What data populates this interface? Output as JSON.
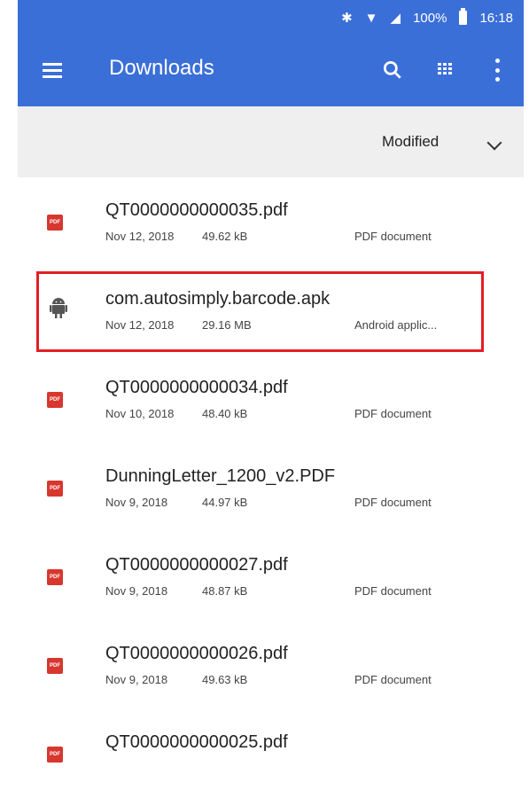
{
  "status": {
    "bluetooth_icon": "bluetooth-icon",
    "wifi_icon": "wifi-icon",
    "signal_icon": "signal-icon",
    "battery_percent": "100%",
    "time": "16:18"
  },
  "toolbar": {
    "title": "Downloads",
    "menu_icon": "menu-icon",
    "search_icon": "search-icon",
    "grid_icon": "grid-view-icon",
    "more_icon": "more-options-icon"
  },
  "sort": {
    "label": "Modified"
  },
  "files": [
    {
      "name": "QT0000000000035.pdf",
      "date": "Nov 12, 2018",
      "size": "49.62 kB",
      "type": "PDF document",
      "icon": "pdf-icon"
    },
    {
      "name": "com.autosimply.barcode.apk",
      "date": "Nov 12, 2018",
      "size": "29.16 MB",
      "type": "Android applic...",
      "icon": "android-icon"
    },
    {
      "name": "QT0000000000034.pdf",
      "date": "Nov 10, 2018",
      "size": "48.40 kB",
      "type": "PDF document",
      "icon": "pdf-icon"
    },
    {
      "name": "DunningLetter_1200_v2.PDF",
      "date": "Nov 9, 2018",
      "size": "44.97 kB",
      "type": "PDF document",
      "icon": "pdf-icon"
    },
    {
      "name": "QT0000000000027.pdf",
      "date": "Nov 9, 2018",
      "size": "48.87 kB",
      "type": "PDF document",
      "icon": "pdf-icon"
    },
    {
      "name": "QT0000000000026.pdf",
      "date": "Nov 9, 2018",
      "size": "49.63 kB",
      "type": "PDF document",
      "icon": "pdf-icon"
    },
    {
      "name": "QT0000000000025.pdf",
      "date": "",
      "size": "",
      "type": "",
      "icon": "pdf-icon"
    }
  ],
  "pdf_badge": "PDF",
  "colors": {
    "app_bar": "#3b6fd8",
    "highlight": "#e31e24",
    "pdf_red": "#d7372f",
    "android_grey": "#555555"
  }
}
